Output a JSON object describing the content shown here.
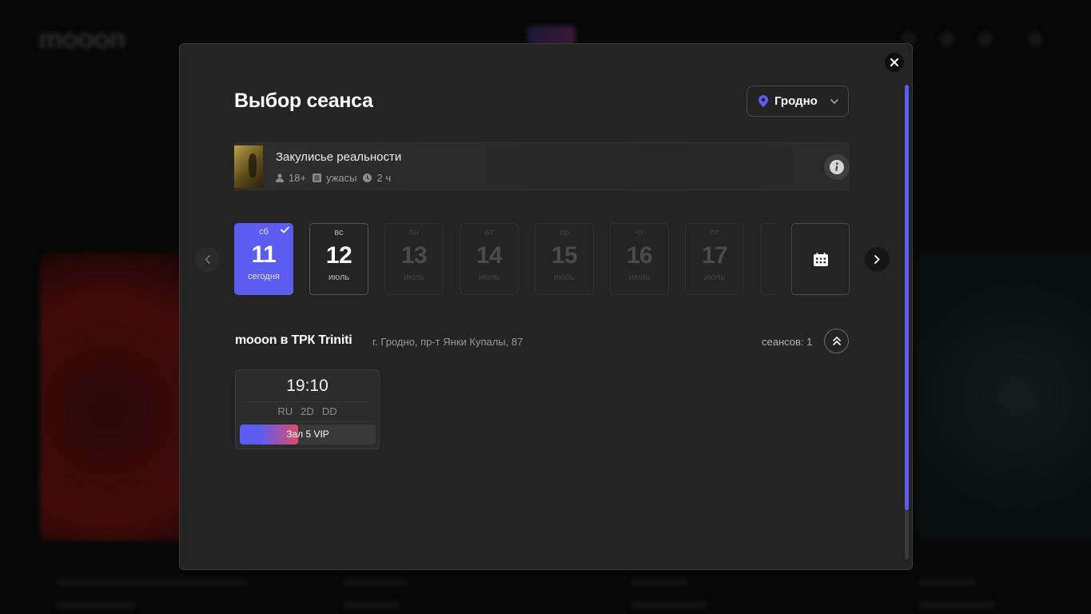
{
  "modal": {
    "title": "Выбор сеанса",
    "city": "Гродно",
    "movie": {
      "name": "Закулисье реальности",
      "age": "18+",
      "genre": "ужасы",
      "duration": "2 ч"
    },
    "dates": [
      {
        "dow": "сб",
        "day": "11",
        "sub": "сегодня",
        "state": "selected"
      },
      {
        "dow": "вс",
        "day": "12",
        "sub": "июль",
        "state": "active"
      },
      {
        "dow": "пн",
        "day": "13",
        "sub": "июль",
        "state": "disabled"
      },
      {
        "dow": "вт",
        "day": "14",
        "sub": "июль",
        "state": "disabled"
      },
      {
        "dow": "ср",
        "day": "15",
        "sub": "июль",
        "state": "disabled"
      },
      {
        "dow": "чт",
        "day": "16",
        "sub": "июль",
        "state": "disabled"
      },
      {
        "dow": "пт",
        "day": "17",
        "sub": "июль",
        "state": "disabled"
      }
    ],
    "cinema": {
      "name": "mooon в ТРК Triniti",
      "address": "г. Гродно, пр-т Янки Купалы, 87",
      "sessions_label": "сеансов: 1"
    },
    "sessions": [
      {
        "time": "19:10",
        "lang": "RU",
        "format": "2D",
        "sound": "DD",
        "hall": "Зал 5 VIP",
        "occupancy": 0.43
      }
    ]
  },
  "colors": {
    "accent": "#5b5df0",
    "modal_bg": "#242424",
    "page_bg": "#0b0b0b",
    "gradient_end": "#e04b6a"
  },
  "icons": [
    "close-icon",
    "map-pin-icon",
    "chevron-down-icon",
    "user-icon",
    "film-icon",
    "clock-icon",
    "info-icon",
    "chevron-left-icon",
    "chevron-right-icon",
    "check-icon",
    "calendar-icon",
    "double-chevron-up-icon"
  ]
}
